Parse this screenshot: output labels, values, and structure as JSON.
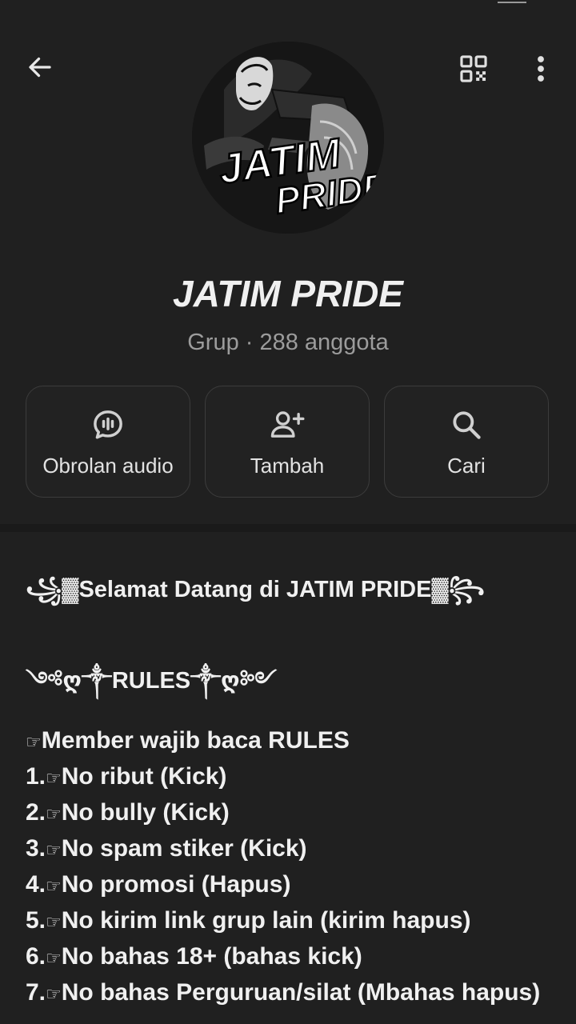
{
  "header": {
    "back_icon": "arrow-left-icon",
    "qr_icon": "qr-code-icon",
    "more_icon": "more-vert-icon"
  },
  "group": {
    "avatar_logo_text": "JATIM PRIDE",
    "name": "JATIM PRIDE",
    "meta": "Grup · 288 anggota"
  },
  "actions": [
    {
      "label": "Obrolan audio",
      "icon": "audio-chat-icon"
    },
    {
      "label": "Tambah",
      "icon": "add-person-icon"
    },
    {
      "label": "Cari",
      "icon": "search-icon"
    }
  ],
  "description": {
    "welcome_left": "꧁▓",
    "welcome_text": "Selamat Datang di JATIM PRIDE",
    "welcome_right": "▓꧂",
    "rules_left": "༺ღ༒",
    "rules_text": "RULES",
    "rules_right": "༒ღ༻",
    "hand_glyph": "☞",
    "intro": "Member wajib baca RULES",
    "rules": [
      {
        "num": "1.",
        "text": "No ribut (Kick)"
      },
      {
        "num": "2.",
        "text": "No bully (Kick)"
      },
      {
        "num": "3.",
        "text": "No spam stiker (Kick)"
      },
      {
        "num": "4.",
        "text": "No promosi (Hapus)"
      },
      {
        "num": "5.",
        "text": "No kirim link grup lain (kirim hapus)"
      },
      {
        "num": "6.",
        "text": "No bahas 18+ (bahas kick)"
      },
      {
        "num": "7.",
        "text": "No bahas Perguruan/silat (Mbahas hapus)"
      }
    ]
  },
  "colors": {
    "background": "#202020",
    "text_primary": "#f0f0f0",
    "text_secondary": "#9c9c9c",
    "button_border": "#3c3c3c",
    "icon": "#d0d0d0"
  }
}
